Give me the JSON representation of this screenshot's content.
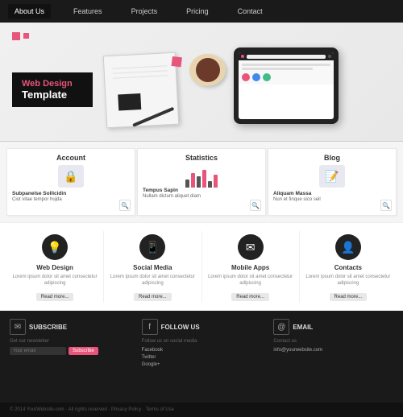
{
  "nav": {
    "items": [
      {
        "label": "About Us",
        "active": true
      },
      {
        "label": "Features",
        "active": false
      },
      {
        "label": "Projects",
        "active": false
      },
      {
        "label": "Pricing",
        "active": false
      },
      {
        "label": "Contact",
        "active": false
      }
    ]
  },
  "hero": {
    "line1": "Web Design",
    "line2": "Template"
  },
  "cards": [
    {
      "title": "Account",
      "subtitle": "Subpanelse Sollicidin",
      "text": "Ciot vitae tempor hujda"
    },
    {
      "title": "Statistics",
      "subtitle": "Tempus Sapin",
      "text": "Nullam dictum aliquet diam"
    },
    {
      "title": "Blog",
      "subtitle": "Aliquam Massa",
      "text": "Nun et finque sico seil"
    }
  ],
  "features": [
    {
      "title": "Web Design",
      "text": "Lorem ipsum dolor sit amet consectetur adipiscing",
      "btn": "Read more..."
    },
    {
      "title": "Social Media",
      "text": "Lorem ipsum dolor sit amet consectetur adipiscing",
      "btn": "Read more..."
    },
    {
      "title": "Mobile Apps",
      "text": "Lorem ipsum dolor sit amet consectetur adipiscing",
      "btn": "Read more..."
    },
    {
      "title": "Contacts",
      "text": "Lorem ipsum dolor sit amet consectetur adipiscing",
      "btn": "Read more..."
    }
  ],
  "footer": {
    "cols": [
      {
        "icon": "✉",
        "label": "Subscribe",
        "sub": "Get our newsletter",
        "input_placeholder": "Your email",
        "btn": "Subscribe"
      },
      {
        "icon": "f",
        "label": "Follow Us",
        "sub": "Follow us on social media",
        "links": [
          "Facebook",
          "Twitter",
          "Google+"
        ]
      },
      {
        "icon": "@",
        "label": "Email",
        "sub": "Contact us",
        "text": "info@yourwebsite.com"
      }
    ],
    "bottom": "© 2014 YourWebsite.com · All rights reserved · Privacy Policy · Terms of Use"
  }
}
